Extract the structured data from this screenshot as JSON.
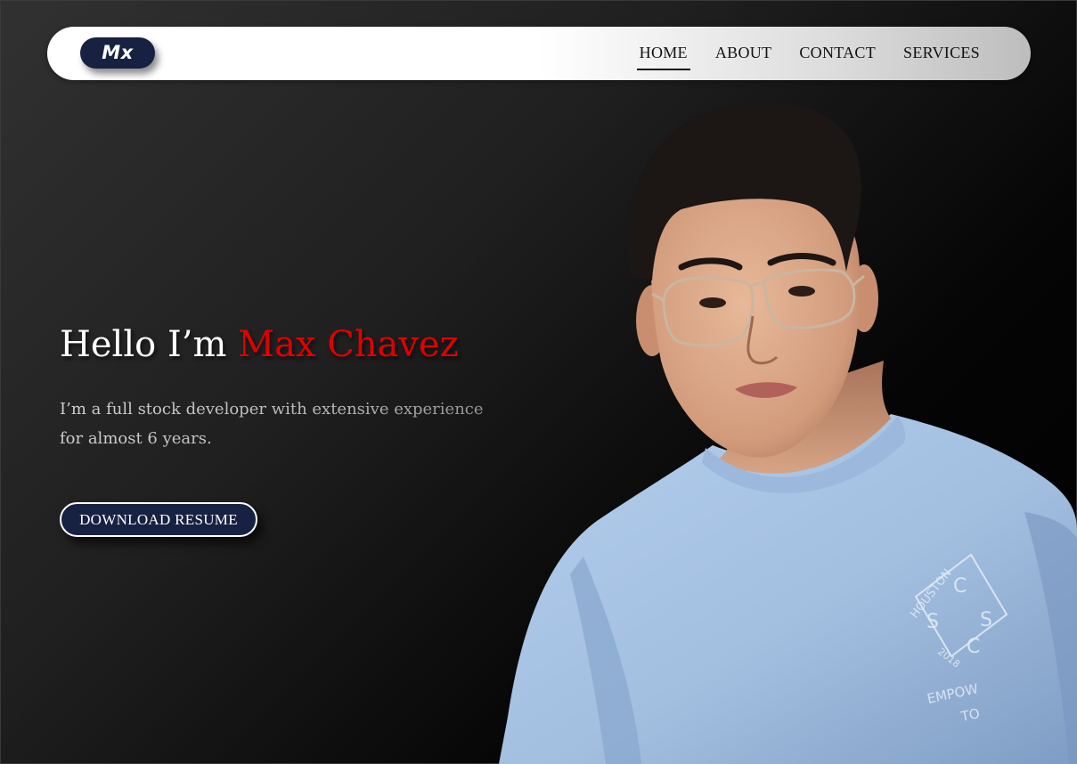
{
  "nav": {
    "logo": "Mx",
    "items": [
      {
        "label": "HOME",
        "active": true
      },
      {
        "label": "ABOUT",
        "active": false
      },
      {
        "label": "CONTACT",
        "active": false
      },
      {
        "label": "SERVICES",
        "active": false
      }
    ]
  },
  "hero": {
    "greeting": "Hello I’m",
    "name": "Max Chavez",
    "description_line1": "I’m a full stock developer with extensive experience",
    "description_line2": "for almost 6 years.",
    "button_label": "DOWNLOAD RESUME"
  },
  "portrait": {
    "shirt_text_1": "HOUSTON",
    "shirt_text_2": "2018",
    "shirt_letters": [
      "C",
      "S",
      "S",
      "C"
    ],
    "shirt_text_3": "EMPOW",
    "shirt_text_4": "TO"
  },
  "colors": {
    "accent_name": "#e00000",
    "button_bg": "#172142",
    "logo_bg": "#172142",
    "shirt": "#a9c4e4"
  }
}
